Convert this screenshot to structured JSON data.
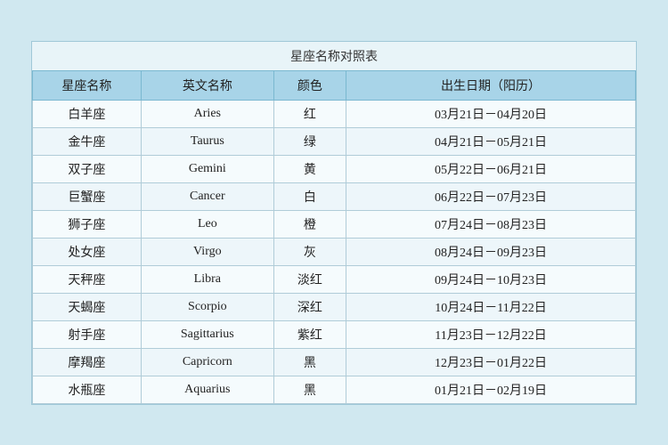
{
  "title": "星座名称对照表",
  "headers": {
    "chinese_name": "星座名称",
    "english_name": "英文名称",
    "color": "颜色",
    "birth_date": "出生日期（阳历）"
  },
  "rows": [
    {
      "chinese": "白羊座",
      "english": "Aries",
      "color": "红",
      "date": "03月21日－04月20日"
    },
    {
      "chinese": "金牛座",
      "english": "Taurus",
      "color": "绿",
      "date": "04月21日－05月21日"
    },
    {
      "chinese": "双子座",
      "english": "Gemini",
      "color": "黄",
      "date": "05月22日－06月21日"
    },
    {
      "chinese": "巨蟹座",
      "english": "Cancer",
      "color": "白",
      "date": "06月22日－07月23日"
    },
    {
      "chinese": "狮子座",
      "english": "Leo",
      "color": "橙",
      "date": "07月24日－08月23日"
    },
    {
      "chinese": "处女座",
      "english": "Virgo",
      "color": "灰",
      "date": "08月24日－09月23日"
    },
    {
      "chinese": "天秤座",
      "english": "Libra",
      "color": "淡红",
      "date": "09月24日－10月23日"
    },
    {
      "chinese": "天蝎座",
      "english": "Scorpio",
      "color": "深红",
      "date": "10月24日－11月22日"
    },
    {
      "chinese": "射手座",
      "english": "Sagittarius",
      "color": "紫红",
      "date": "11月23日－12月22日"
    },
    {
      "chinese": "摩羯座",
      "english": "Capricorn",
      "color": "黑",
      "date": "12月23日－01月22日"
    },
    {
      "chinese": "水瓶座",
      "english": "Aquarius",
      "color": "黑",
      "date": "01月21日－02月19日"
    }
  ]
}
